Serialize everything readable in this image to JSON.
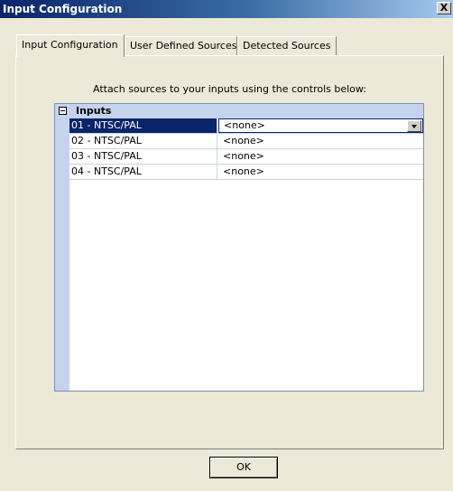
{
  "window": {
    "title": "Input Configuration",
    "close_label": "X"
  },
  "tabs": [
    {
      "label": "Input Configuration"
    },
    {
      "label": "User Defined Sources"
    },
    {
      "label": "Detected Sources"
    }
  ],
  "panel": {
    "instruction": "Attach sources to your inputs using the controls below:"
  },
  "grid": {
    "category": "Inputs",
    "rows": [
      {
        "name": "01 - NTSC/PAL",
        "value": "<none>"
      },
      {
        "name": "02 - NTSC/PAL",
        "value": "<none>"
      },
      {
        "name": "03 - NTSC/PAL",
        "value": "<none>"
      },
      {
        "name": "04 - NTSC/PAL",
        "value": "<none>"
      }
    ]
  },
  "buttons": {
    "ok_label": "OK"
  }
}
